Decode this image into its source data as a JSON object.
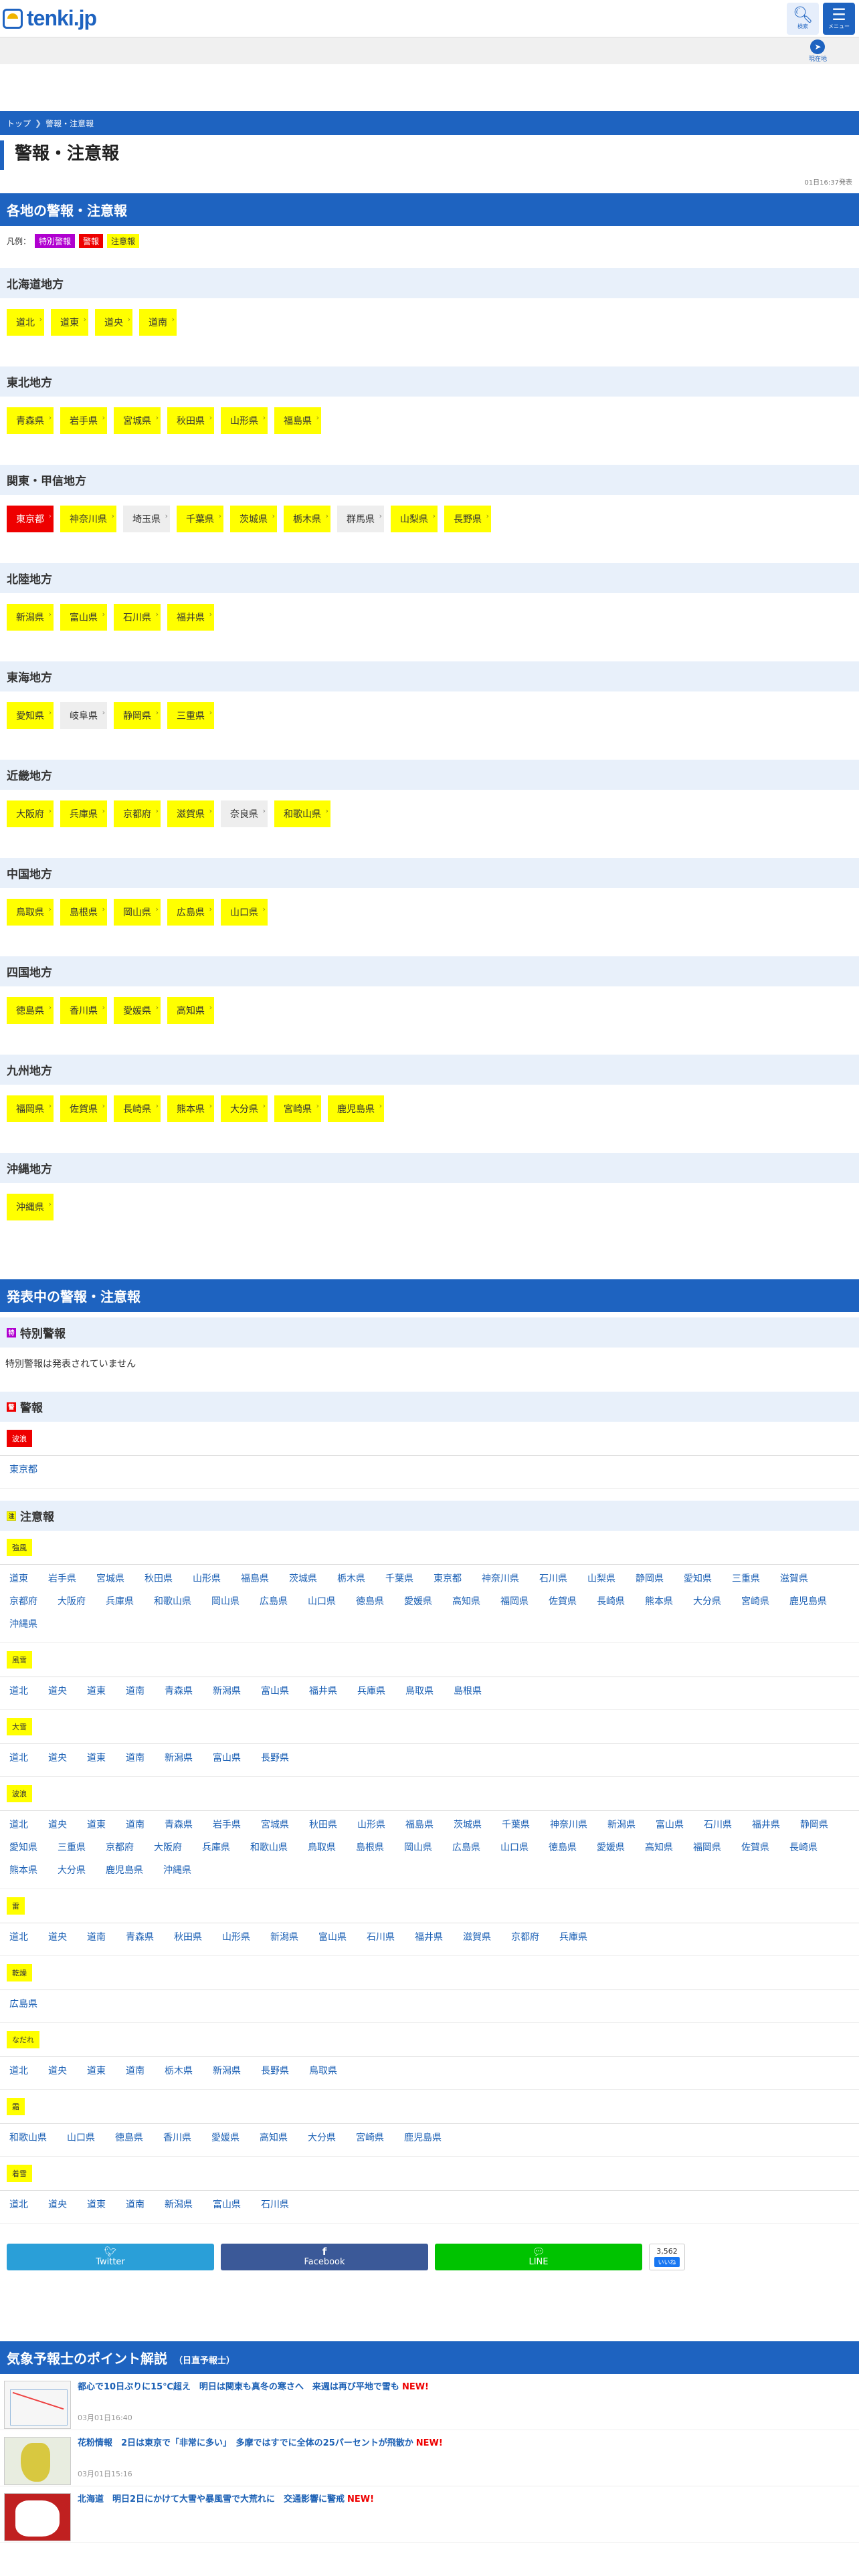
{
  "header": {
    "logo_text": "tenki.jp",
    "search_label": "検索",
    "menu_label": "メニュー",
    "location_label": "現在地"
  },
  "breadcrumb": [
    "トップ",
    "警報・注意報"
  ],
  "page_title": "警報・注意報",
  "timestamp": "01日16:37発表",
  "map_section": {
    "title": "各地の警報・注意報",
    "legend_label": "凡例：",
    "legend": [
      "特別警報",
      "警報",
      "注意報"
    ],
    "regions": [
      {
        "name": "北海道地方",
        "prefs": [
          {
            "n": "道北",
            "s": "y"
          },
          {
            "n": "道東",
            "s": "y"
          },
          {
            "n": "道央",
            "s": "y"
          },
          {
            "n": "道南",
            "s": "y"
          }
        ]
      },
      {
        "name": "東北地方",
        "prefs": [
          {
            "n": "青森県",
            "s": "y"
          },
          {
            "n": "岩手県",
            "s": "y"
          },
          {
            "n": "宮城県",
            "s": "y"
          },
          {
            "n": "秋田県",
            "s": "y"
          },
          {
            "n": "山形県",
            "s": "y"
          },
          {
            "n": "福島県",
            "s": "y"
          }
        ]
      },
      {
        "name": "関東・甲信地方",
        "prefs": [
          {
            "n": "東京都",
            "s": "r"
          },
          {
            "n": "神奈川県",
            "s": "y"
          },
          {
            "n": "埼玉県",
            "s": "n"
          },
          {
            "n": "千葉県",
            "s": "y"
          },
          {
            "n": "茨城県",
            "s": "y"
          },
          {
            "n": "栃木県",
            "s": "y"
          },
          {
            "n": "群馬県",
            "s": "n"
          },
          {
            "n": "山梨県",
            "s": "y"
          },
          {
            "n": "長野県",
            "s": "y"
          }
        ]
      },
      {
        "name": "北陸地方",
        "prefs": [
          {
            "n": "新潟県",
            "s": "y"
          },
          {
            "n": "富山県",
            "s": "y"
          },
          {
            "n": "石川県",
            "s": "y"
          },
          {
            "n": "福井県",
            "s": "y"
          }
        ]
      },
      {
        "name": "東海地方",
        "prefs": [
          {
            "n": "愛知県",
            "s": "y"
          },
          {
            "n": "岐阜県",
            "s": "n"
          },
          {
            "n": "静岡県",
            "s": "y"
          },
          {
            "n": "三重県",
            "s": "y"
          }
        ]
      },
      {
        "name": "近畿地方",
        "prefs": [
          {
            "n": "大阪府",
            "s": "y"
          },
          {
            "n": "兵庫県",
            "s": "y"
          },
          {
            "n": "京都府",
            "s": "y"
          },
          {
            "n": "滋賀県",
            "s": "y"
          },
          {
            "n": "奈良県",
            "s": "n"
          },
          {
            "n": "和歌山県",
            "s": "y"
          }
        ]
      },
      {
        "name": "中国地方",
        "prefs": [
          {
            "n": "鳥取県",
            "s": "y"
          },
          {
            "n": "島根県",
            "s": "y"
          },
          {
            "n": "岡山県",
            "s": "y"
          },
          {
            "n": "広島県",
            "s": "y"
          },
          {
            "n": "山口県",
            "s": "y"
          }
        ]
      },
      {
        "name": "四国地方",
        "prefs": [
          {
            "n": "徳島県",
            "s": "y"
          },
          {
            "n": "香川県",
            "s": "y"
          },
          {
            "n": "愛媛県",
            "s": "y"
          },
          {
            "n": "高知県",
            "s": "y"
          }
        ]
      },
      {
        "name": "九州地方",
        "prefs": [
          {
            "n": "福岡県",
            "s": "y"
          },
          {
            "n": "佐賀県",
            "s": "y"
          },
          {
            "n": "長崎県",
            "s": "y"
          },
          {
            "n": "熊本県",
            "s": "y"
          },
          {
            "n": "大分県",
            "s": "y"
          },
          {
            "n": "宮崎県",
            "s": "y"
          },
          {
            "n": "鹿児島県",
            "s": "y"
          }
        ]
      },
      {
        "name": "沖縄地方",
        "prefs": [
          {
            "n": "沖縄県",
            "s": "y"
          }
        ]
      }
    ]
  },
  "issued_section": {
    "title": "発表中の警報・注意報",
    "special": {
      "icon": "特",
      "title": "特別警報",
      "none_text": "特別警報は発表されていません"
    },
    "warning": {
      "icon": "警",
      "title": "警報",
      "kinds": [
        {
          "label": "波浪",
          "areas": [
            "東京都"
          ]
        }
      ]
    },
    "advisory": {
      "icon": "注",
      "title": "注意報",
      "kinds": [
        {
          "label": "強風",
          "areas": [
            "道東",
            "岩手県",
            "宮城県",
            "秋田県",
            "山形県",
            "福島県",
            "茨城県",
            "栃木県",
            "千葉県",
            "東京都",
            "神奈川県",
            "石川県",
            "山梨県",
            "静岡県",
            "愛知県",
            "三重県",
            "滋賀県",
            "京都府",
            "大阪府",
            "兵庫県",
            "和歌山県",
            "岡山県",
            "広島県",
            "山口県",
            "徳島県",
            "愛媛県",
            "高知県",
            "福岡県",
            "佐賀県",
            "長崎県",
            "熊本県",
            "大分県",
            "宮崎県",
            "鹿児島県",
            "沖縄県"
          ]
        },
        {
          "label": "風雪",
          "areas": [
            "道北",
            "道央",
            "道東",
            "道南",
            "青森県",
            "新潟県",
            "富山県",
            "福井県",
            "兵庫県",
            "鳥取県",
            "島根県"
          ]
        },
        {
          "label": "大雪",
          "areas": [
            "道北",
            "道央",
            "道東",
            "道南",
            "新潟県",
            "富山県",
            "長野県"
          ]
        },
        {
          "label": "波浪",
          "areas": [
            "道北",
            "道央",
            "道東",
            "道南",
            "青森県",
            "岩手県",
            "宮城県",
            "秋田県",
            "山形県",
            "福島県",
            "茨城県",
            "千葉県",
            "神奈川県",
            "新潟県",
            "富山県",
            "石川県",
            "福井県",
            "静岡県",
            "愛知県",
            "三重県",
            "京都府",
            "大阪府",
            "兵庫県",
            "和歌山県",
            "鳥取県",
            "島根県",
            "岡山県",
            "広島県",
            "山口県",
            "徳島県",
            "愛媛県",
            "高知県",
            "福岡県",
            "佐賀県",
            "長崎県",
            "熊本県",
            "大分県",
            "鹿児島県",
            "沖縄県"
          ]
        },
        {
          "label": "雷",
          "areas": [
            "道北",
            "道央",
            "道南",
            "青森県",
            "秋田県",
            "山形県",
            "新潟県",
            "富山県",
            "石川県",
            "福井県",
            "滋賀県",
            "京都府",
            "兵庫県"
          ]
        },
        {
          "label": "乾燥",
          "areas": [
            "広島県"
          ]
        },
        {
          "label": "なだれ",
          "areas": [
            "道北",
            "道央",
            "道東",
            "道南",
            "栃木県",
            "新潟県",
            "長野県",
            "鳥取県"
          ]
        },
        {
          "label": "霜",
          "areas": [
            "和歌山県",
            "山口県",
            "徳島県",
            "香川県",
            "愛媛県",
            "高知県",
            "大分県",
            "宮崎県",
            "鹿児島県"
          ]
        },
        {
          "label": "着雪",
          "areas": [
            "道北",
            "道央",
            "道東",
            "道南",
            "新潟県",
            "富山県",
            "石川県"
          ]
        }
      ]
    }
  },
  "share": {
    "twitter": "Twitter",
    "facebook": "Facebook",
    "line": "LINE",
    "count": "3,562",
    "like": "いいね"
  },
  "points_section": {
    "title": "気象予報士のポイント解説",
    "subtitle": "（日直予報士）",
    "items": [
      {
        "title": "都心で10日ぶりに15℃超え　明日は関東も真冬の寒さへ　来週は再び平地で雪も",
        "new": "NEW!",
        "date": "03月01日16:40"
      },
      {
        "title": "花粉情報　2日は東京で「非常に多い」　多摩ではすでに全体の25パーセントが飛散か",
        "new": "NEW!",
        "date": "03月01日15:16"
      },
      {
        "title": "北海道　明日2日にかけて大雪や暴風雪で大荒れに　交通影響に警戒",
        "new": "NEW!",
        "date": ""
      }
    ]
  }
}
